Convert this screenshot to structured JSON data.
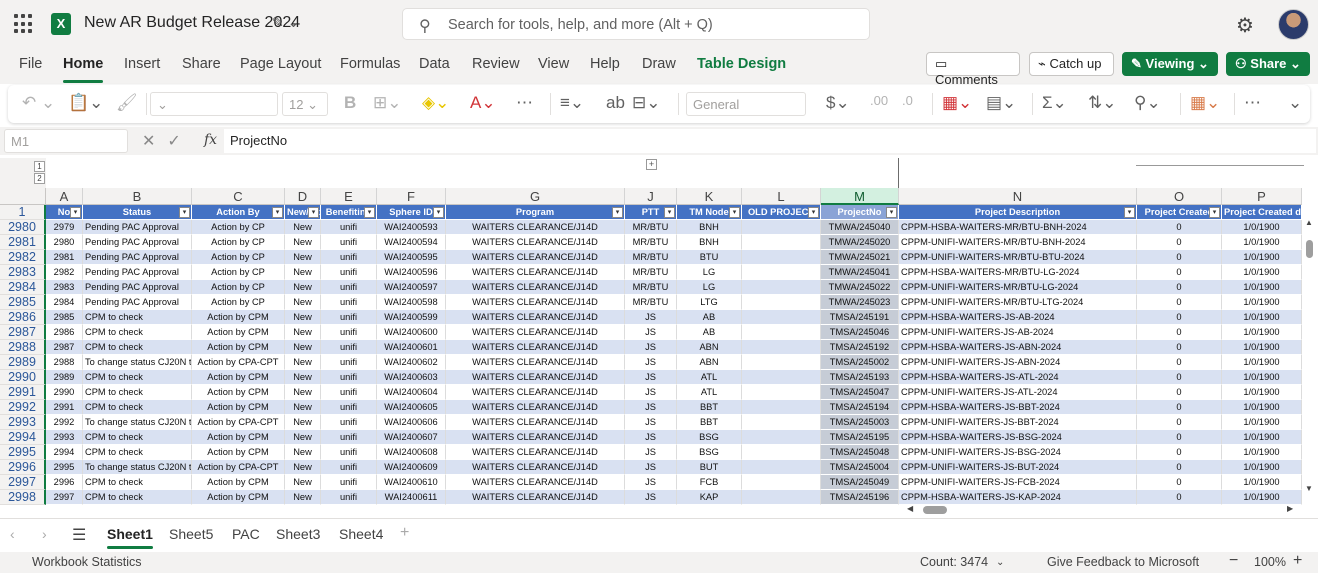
{
  "app": {
    "title": "New AR Budget Release 2024",
    "logo_letter": "X"
  },
  "search": {
    "placeholder": "Search for tools, help, and more (Alt + Q)"
  },
  "menu": {
    "items": [
      "File",
      "Home",
      "Insert",
      "Share",
      "Page Layout",
      "Formulas",
      "Data",
      "Review",
      "View",
      "Help",
      "Draw",
      "Table Design"
    ],
    "active": "Home",
    "comments": "Comments",
    "catch_up": "Catch up",
    "viewing": "Viewing",
    "share": "Share"
  },
  "ribbon": {
    "font_size": "12",
    "number_format": "General"
  },
  "formula_bar": {
    "name_box": "M1",
    "fx": "fx",
    "content": "ProjectNo"
  },
  "outline_levels": [
    "1",
    "2"
  ],
  "columns": [
    "A",
    "B",
    "C",
    "D",
    "E",
    "F",
    "G",
    "J",
    "K",
    "L",
    "M",
    "N",
    "O",
    "P"
  ],
  "selected_column": "M",
  "header_row_number": "1",
  "table_headers": [
    "No",
    "Status",
    "Action By",
    "New/Ex",
    "Benefiting",
    "Sphere ID",
    "Program",
    "PTT",
    "TM Node",
    "OLD PROJECT",
    "ProjectNo",
    "Project Description",
    "Project Created",
    "Project Created d"
  ],
  "rows": [
    {
      "r": "2980",
      "cells": [
        "2979",
        "Pending PAC Approval",
        "Action by CP",
        "New",
        "unifi",
        "WAI2400593",
        "WAITERS CLEARANCE/J14D",
        "MR/BTU",
        "BNH",
        "",
        "TMWA/245040",
        "CPPM-HSBA-WAITERS-MR/BTU-BNH-2024",
        "0",
        "1/0/1900"
      ]
    },
    {
      "r": "2981",
      "cells": [
        "2980",
        "Pending PAC Approval",
        "Action by CP",
        "New",
        "unifi",
        "WAI2400594",
        "WAITERS CLEARANCE/J14D",
        "MR/BTU",
        "BNH",
        "",
        "TMWA/245020",
        "CPPM-UNIFI-WAITERS-MR/BTU-BNH-2024",
        "0",
        "1/0/1900"
      ]
    },
    {
      "r": "2982",
      "cells": [
        "2981",
        "Pending PAC Approval",
        "Action by CP",
        "New",
        "unifi",
        "WAI2400595",
        "WAITERS CLEARANCE/J14D",
        "MR/BTU",
        "BTU",
        "",
        "TMWA/245021",
        "CPPM-UNIFI-WAITERS-MR/BTU-BTU-2024",
        "0",
        "1/0/1900"
      ]
    },
    {
      "r": "2983",
      "cells": [
        "2982",
        "Pending PAC Approval",
        "Action by CP",
        "New",
        "unifi",
        "WAI2400596",
        "WAITERS CLEARANCE/J14D",
        "MR/BTU",
        "LG",
        "",
        "TMWA/245041",
        "CPPM-HSBA-WAITERS-MR/BTU-LG-2024",
        "0",
        "1/0/1900"
      ]
    },
    {
      "r": "2984",
      "cells": [
        "2983",
        "Pending PAC Approval",
        "Action by CP",
        "New",
        "unifi",
        "WAI2400597",
        "WAITERS CLEARANCE/J14D",
        "MR/BTU",
        "LG",
        "",
        "TMWA/245022",
        "CPPM-UNIFI-WAITERS-MR/BTU-LG-2024",
        "0",
        "1/0/1900"
      ]
    },
    {
      "r": "2985",
      "cells": [
        "2984",
        "Pending PAC Approval",
        "Action by CP",
        "New",
        "unifi",
        "WAI2400598",
        "WAITERS CLEARANCE/J14D",
        "MR/BTU",
        "LTG",
        "",
        "TMWA/245023",
        "CPPM-UNIFI-WAITERS-MR/BTU-LTG-2024",
        "0",
        "1/0/1900"
      ]
    },
    {
      "r": "2986",
      "cells": [
        "2985",
        "CPM to check",
        "Action by CPM",
        "New",
        "unifi",
        "WAI2400599",
        "WAITERS CLEARANCE/J14D",
        "JS",
        "AB",
        "",
        "TMSA/245191",
        "CPPM-HSBA-WAITERS-JS-AB-2024",
        "0",
        "1/0/1900"
      ]
    },
    {
      "r": "2987",
      "cells": [
        "2986",
        "CPM to check",
        "Action by CPM",
        "New",
        "unifi",
        "WAI2400600",
        "WAITERS CLEARANCE/J14D",
        "JS",
        "AB",
        "",
        "TMSA/245046",
        "CPPM-UNIFI-WAITERS-JS-AB-2024",
        "0",
        "1/0/1900"
      ]
    },
    {
      "r": "2988",
      "cells": [
        "2987",
        "CPM to check",
        "Action by CPM",
        "New",
        "unifi",
        "WAI2400601",
        "WAITERS CLEARANCE/J14D",
        "JS",
        "ABN",
        "",
        "TMSA/245192",
        "CPPM-HSBA-WAITERS-JS-ABN-2024",
        "0",
        "1/0/1900"
      ]
    },
    {
      "r": "2989",
      "cells": [
        "2988",
        "To change status CJ20N t",
        "Action by CPA-CPT",
        "New",
        "unifi",
        "WAI2400602",
        "WAITERS CLEARANCE/J14D",
        "JS",
        "ABN",
        "",
        "TMSA/245002",
        "CPPM-UNIFI-WAITERS-JS-ABN-2024",
        "0",
        "1/0/1900"
      ]
    },
    {
      "r": "2990",
      "cells": [
        "2989",
        "CPM to check",
        "Action by CPM",
        "New",
        "unifi",
        "WAI2400603",
        "WAITERS CLEARANCE/J14D",
        "JS",
        "ATL",
        "",
        "TMSA/245193",
        "CPPM-HSBA-WAITERS-JS-ATL-2024",
        "0",
        "1/0/1900"
      ]
    },
    {
      "r": "2991",
      "cells": [
        "2990",
        "CPM to check",
        "Action by CPM",
        "New",
        "unifi",
        "WAI2400604",
        "WAITERS CLEARANCE/J14D",
        "JS",
        "ATL",
        "",
        "TMSA/245047",
        "CPPM-UNIFI-WAITERS-JS-ATL-2024",
        "0",
        "1/0/1900"
      ]
    },
    {
      "r": "2992",
      "cells": [
        "2991",
        "CPM to check",
        "Action by CPM",
        "New",
        "unifi",
        "WAI2400605",
        "WAITERS CLEARANCE/J14D",
        "JS",
        "BBT",
        "",
        "TMSA/245194",
        "CPPM-HSBA-WAITERS-JS-BBT-2024",
        "0",
        "1/0/1900"
      ]
    },
    {
      "r": "2993",
      "cells": [
        "2992",
        "To change status CJ20N t",
        "Action by CPA-CPT",
        "New",
        "unifi",
        "WAI2400606",
        "WAITERS CLEARANCE/J14D",
        "JS",
        "BBT",
        "",
        "TMSA/245003",
        "CPPM-UNIFI-WAITERS-JS-BBT-2024",
        "0",
        "1/0/1900"
      ]
    },
    {
      "r": "2994",
      "cells": [
        "2993",
        "CPM to check",
        "Action by CPM",
        "New",
        "unifi",
        "WAI2400607",
        "WAITERS CLEARANCE/J14D",
        "JS",
        "BSG",
        "",
        "TMSA/245195",
        "CPPM-HSBA-WAITERS-JS-BSG-2024",
        "0",
        "1/0/1900"
      ]
    },
    {
      "r": "2995",
      "cells": [
        "2994",
        "CPM to check",
        "Action by CPM",
        "New",
        "unifi",
        "WAI2400608",
        "WAITERS CLEARANCE/J14D",
        "JS",
        "BSG",
        "",
        "TMSA/245048",
        "CPPM-UNIFI-WAITERS-JS-BSG-2024",
        "0",
        "1/0/1900"
      ]
    },
    {
      "r": "2996",
      "cells": [
        "2995",
        "To change status CJ20N t",
        "Action by CPA-CPT",
        "New",
        "unifi",
        "WAI2400609",
        "WAITERS CLEARANCE/J14D",
        "JS",
        "BUT",
        "",
        "TMSA/245004",
        "CPPM-UNIFI-WAITERS-JS-BUT-2024",
        "0",
        "1/0/1900"
      ]
    },
    {
      "r": "2997",
      "cells": [
        "2996",
        "CPM to check",
        "Action by CPM",
        "New",
        "unifi",
        "WAI2400610",
        "WAITERS CLEARANCE/J14D",
        "JS",
        "FCB",
        "",
        "TMSA/245049",
        "CPPM-UNIFI-WAITERS-JS-FCB-2024",
        "0",
        "1/0/1900"
      ]
    },
    {
      "r": "2998",
      "cells": [
        "2997",
        "CPM to check",
        "Action by CPM",
        "New",
        "unifi",
        "WAI2400611",
        "WAITERS CLEARANCE/J14D",
        "JS",
        "KAP",
        "",
        "TMSA/245196",
        "CPPM-HSBA-WAITERS-JS-KAP-2024",
        "0",
        "1/0/1900"
      ]
    }
  ],
  "sheets": {
    "tabs": [
      "Sheet1",
      "Sheet5",
      "PAC",
      "Sheet3",
      "Sheet4"
    ],
    "active": "Sheet1"
  },
  "status": {
    "left": "Workbook Statistics",
    "count": "Count: 3474",
    "feedback": "Give Feedback to Microsoft",
    "zoom": "100%"
  },
  "colors": {
    "accent": "#107c41",
    "table_header": "#4472c4",
    "band": "#d9e1f2"
  },
  "icons": [
    "waffle-icon",
    "excel-logo",
    "edit-icon",
    "search-icon",
    "gear-icon",
    "comment-icon",
    "undo-icon",
    "paste-icon",
    "format-painter-icon",
    "bold-icon",
    "borders-icon",
    "fill-color-icon",
    "font-color-icon",
    "more-icon",
    "align-icon",
    "wrap-icon",
    "merge-icon",
    "currency-icon",
    "sum-icon",
    "sort-filter-icon",
    "find-icon",
    "cells-icon"
  ]
}
